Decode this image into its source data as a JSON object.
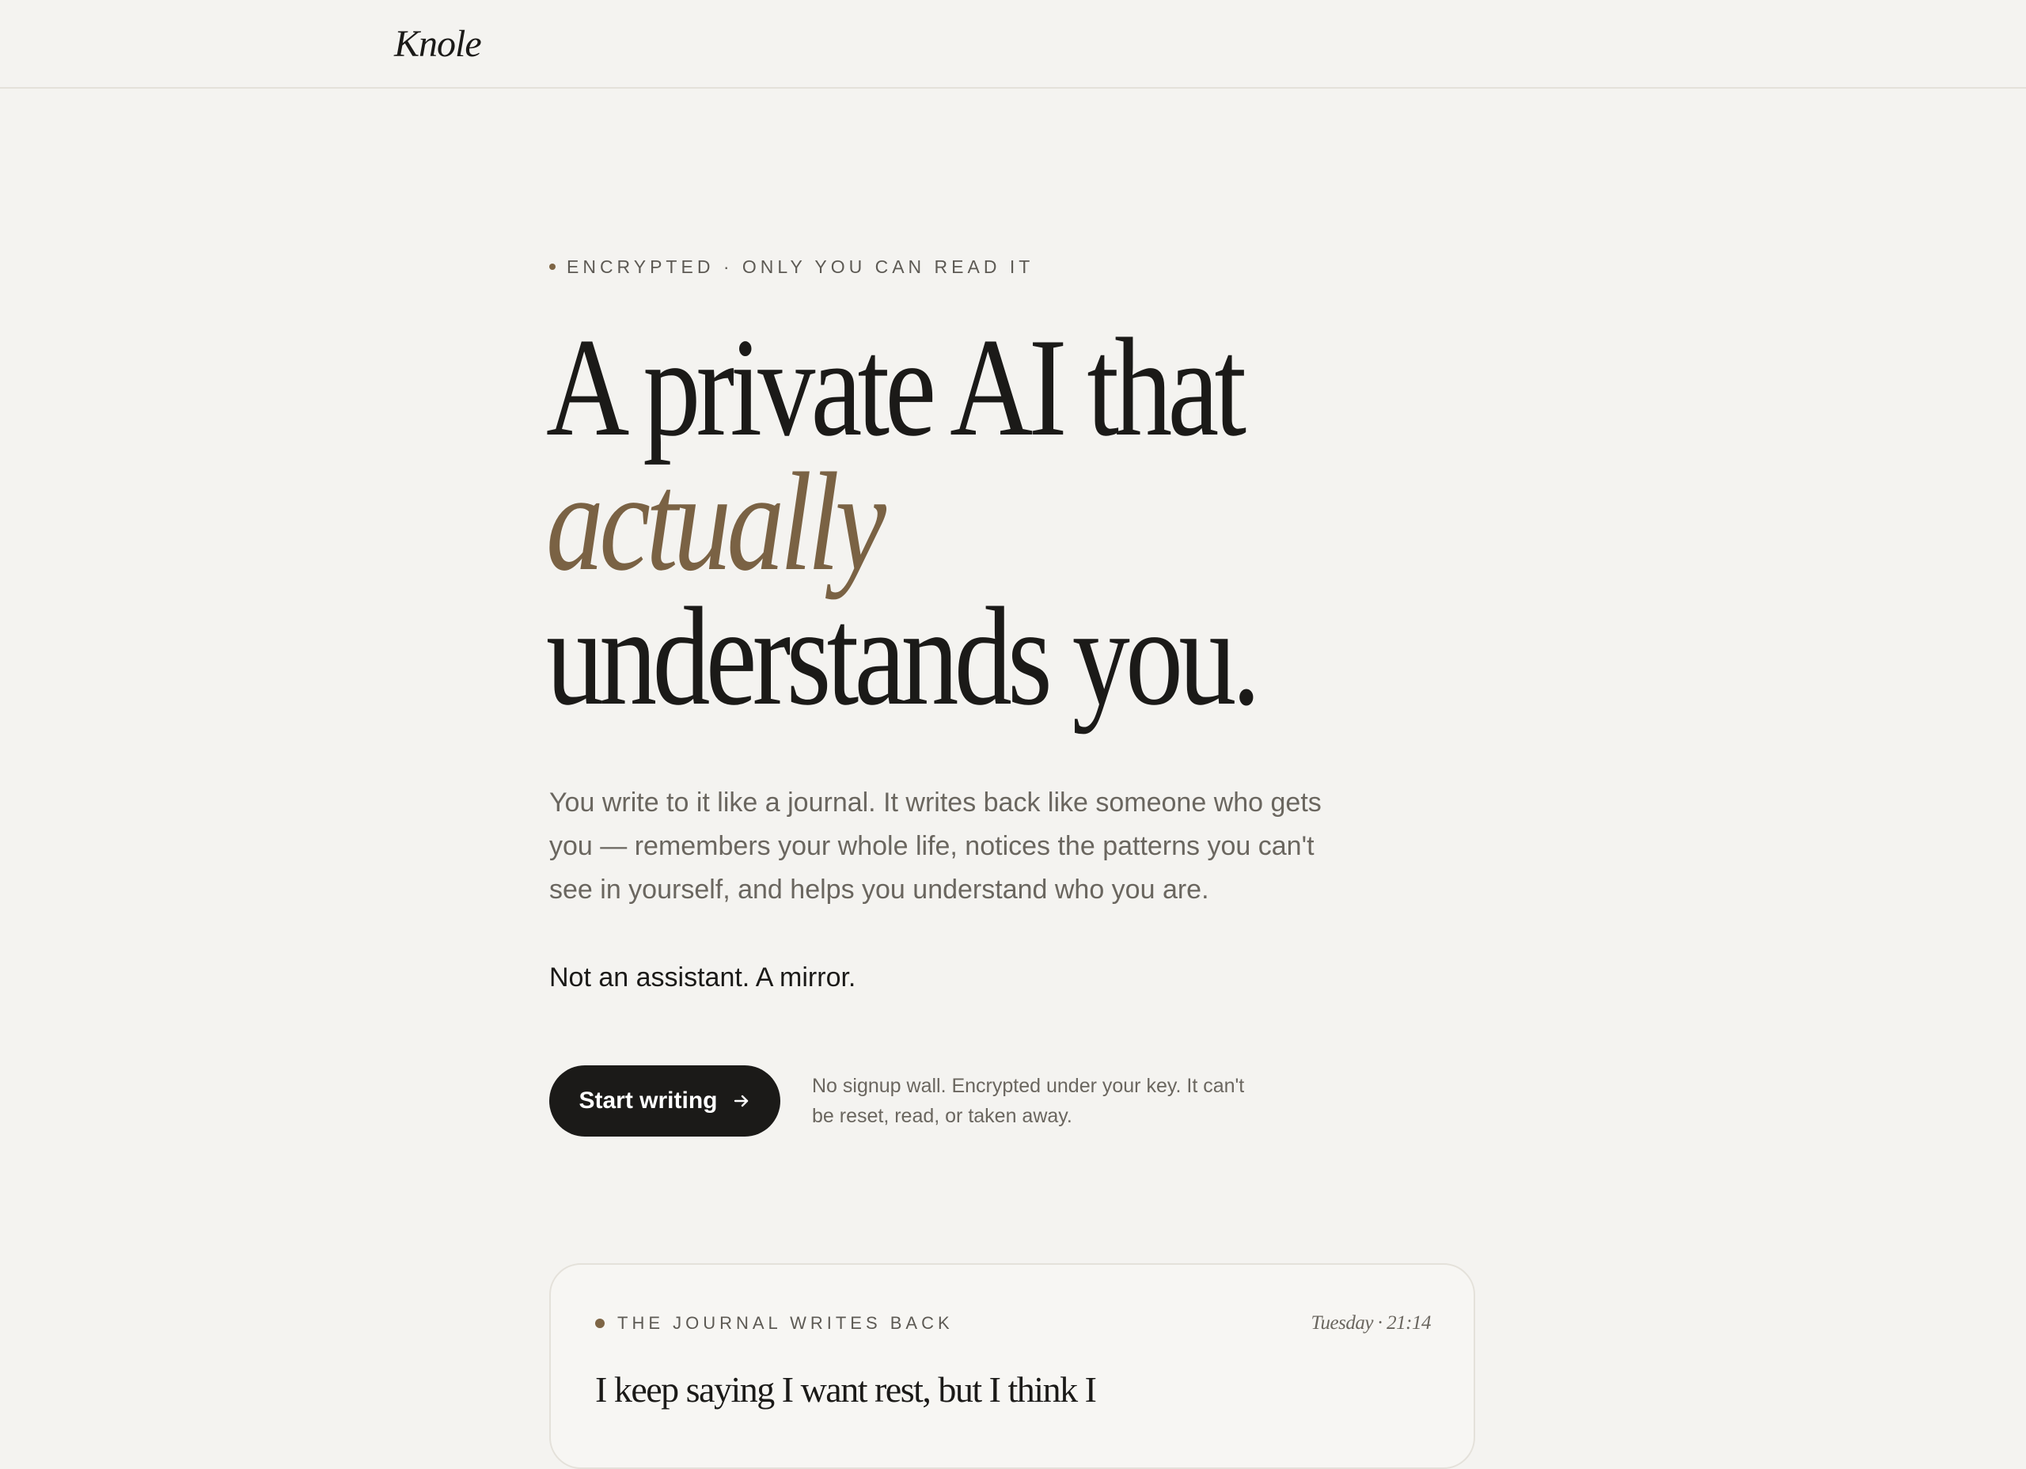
{
  "header": {
    "logo": "Knole"
  },
  "hero": {
    "eyebrow": "ENCRYPTED · ONLY YOU CAN READ IT",
    "headline": {
      "line1": "A private AI that",
      "line2": "actually",
      "line3": "understands you."
    },
    "lede": "You write to it like a journal. It writes back like someone who gets you — remembers your whole life, notices the patterns you can't see in yourself, and helps you understand who you are.",
    "lede_strong": "Not an assistant. A mirror.",
    "cta_label": "Start writing",
    "cta_icon": "arrow-right-icon",
    "cta_note": "No signup wall. Encrypted under your key. It can't be reset, read, or taken away."
  },
  "preview_card": {
    "eyebrow": "THE JOURNAL WRITES BACK",
    "timestamp": "Tuesday · 21:14",
    "text": "I keep saying I want rest, but I think I"
  },
  "colors": {
    "background": "#f4f3f0",
    "ink": "#1b1a18",
    "accent": "#7a6244",
    "muted": "#6a665f",
    "border": "#e4e1da"
  }
}
